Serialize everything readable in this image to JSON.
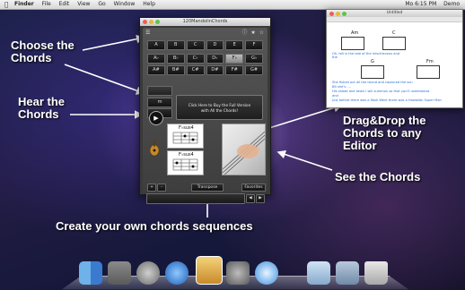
{
  "menubar": {
    "apple": "",
    "menus": [
      "Finder",
      "File",
      "Edit",
      "View",
      "Go",
      "Window",
      "Help"
    ],
    "status": "Mo 6:15 PM",
    "user": "Demo"
  },
  "callouts": {
    "choose": "Choose the\nChords",
    "hear": "Hear the\nChords",
    "drag": "Drag&Drop the\nChords to any\nEditor",
    "see": "See the Chords",
    "create": "Create your own chords sequences"
  },
  "app": {
    "title": "120MandolinChords",
    "top_icons": "ⓘ ★ ☆",
    "keys": [
      "A",
      "B",
      "C",
      "D",
      "E",
      "F",
      "G",
      "A♭",
      "B♭",
      "C♭",
      "D♭",
      "E♭",
      "F♭",
      "G♭",
      "A#",
      "B#",
      "C#",
      "D#",
      "E#",
      "F#",
      "G#"
    ],
    "selected_key": "F♭",
    "mod_buttons": [
      "",
      "m",
      ""
    ],
    "buy_text": "Click Here to Buy the Full Version\nwith All the Chords!",
    "play_icon": "▶",
    "diagrams": [
      "F♭sus4",
      "F♭sus4"
    ],
    "transpose_label": "Transpose",
    "favorites_label": "Favorites",
    "plus_label": "+",
    "minus_label": "-",
    "seq_nav_prev": "◀",
    "seq_nav_next": "▶",
    "accent_color": "#ffffff"
  },
  "editor": {
    "title": "Untitled",
    "chords_row1": [
      "Am",
      "C"
    ],
    "chords_row2": [
      "G",
      "Fm"
    ],
    "lines": [
      "Oh, tell is the tale of the mischievous and",
      "  the",
      "She fished out all the island and captured the sun",
      "Bit she's ....",
      "His shade and tasks I will summon so that you'll understand",
      "  and",
      "Just before there was a flash Went there was a Hawaiian Super Man"
    ]
  },
  "dock": {
    "icons": [
      "finder-icon",
      "app-icon",
      "rocket-icon",
      "app-store-icon",
      "mandolin-chords-icon",
      "settings-icon",
      "safari-icon",
      "folder-icon",
      "downloads-icon",
      "trash-icon"
    ]
  }
}
